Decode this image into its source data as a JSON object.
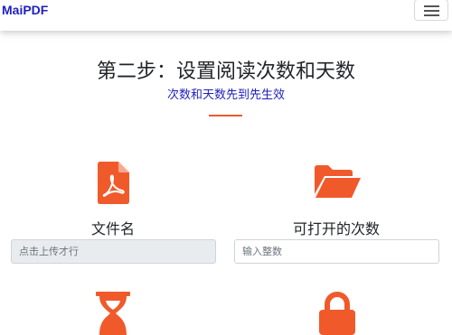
{
  "navbar": {
    "brand": "MaiPDF",
    "menu_icon": "hamburger-menu-icon"
  },
  "main": {
    "title": "第二步：设置阅读次数和天数",
    "subtitle": "次数和天数先到先生效"
  },
  "features": [
    {
      "label": "文件名",
      "icon": "pdf-file-icon",
      "input_placeholder": "点击上传才行"
    },
    {
      "label": "可打开的次数",
      "icon": "folder-open-icon",
      "input_placeholder": "输入整数"
    },
    {
      "icon": "hourglass-icon"
    },
    {
      "icon": "lock-icon"
    }
  ],
  "colors": {
    "accent": "#f05a2b",
    "brand": "#1f1fbf",
    "subtitle": "#1f1fbf"
  }
}
